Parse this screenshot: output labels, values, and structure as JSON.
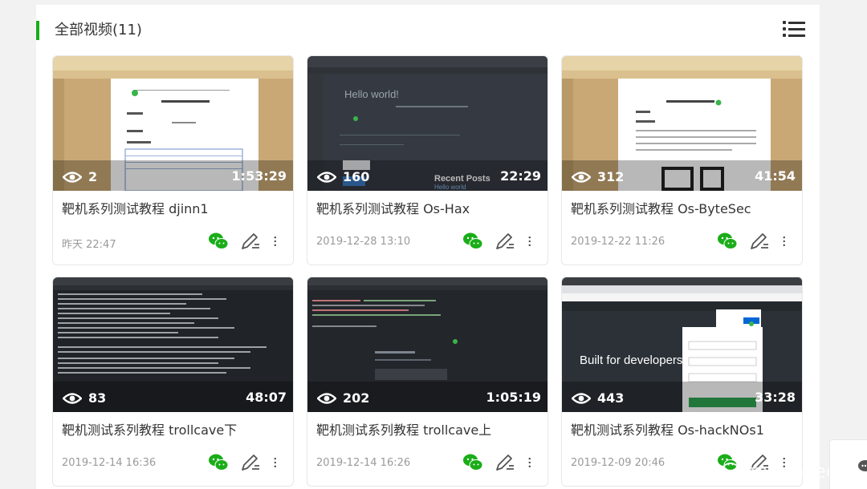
{
  "section": {
    "title": "全部视频(11)"
  },
  "watermark": "moonsec",
  "colors": {
    "accent": "#1aad19",
    "wechat": "#1aad19"
  },
  "cards": [
    {
      "title": "靶机系列测试教程 djinn1",
      "date": "昨天 22:47",
      "views": "2",
      "duration": "1:53:29",
      "thumb": "doc"
    },
    {
      "title": "靶机系列测试教程 Os-Hax",
      "date": "2019-12-28 13:10",
      "views": "160",
      "duration": "22:29",
      "thumb": "dark"
    },
    {
      "title": "靶机系列测试教程 Os-ByteSec",
      "date": "2019-12-22 11:26",
      "views": "312",
      "duration": "41:54",
      "thumb": "doc"
    },
    {
      "title": "靶机测试系列教程 trollcave下",
      "date": "2019-12-14 16:36",
      "views": "83",
      "duration": "48:07",
      "thumb": "term"
    },
    {
      "title": "靶机测试系列教程 trollcave上",
      "date": "2019-12-14 16:26",
      "views": "202",
      "duration": "1:05:19",
      "thumb": "term"
    },
    {
      "title": "靶机测试系列教程 Os-hackNOs1",
      "date": "2019-12-09 20:46",
      "views": "443",
      "duration": "33:28",
      "thumb": "git"
    }
  ],
  "thumb_text": {
    "hello": "Hello world!",
    "recent": "Recent Posts",
    "recent_link": "Hello world",
    "built": "Built for developers"
  },
  "icons": [
    "list-icon",
    "eye-icon",
    "wechat-icon",
    "edit-icon",
    "more-icon"
  ]
}
